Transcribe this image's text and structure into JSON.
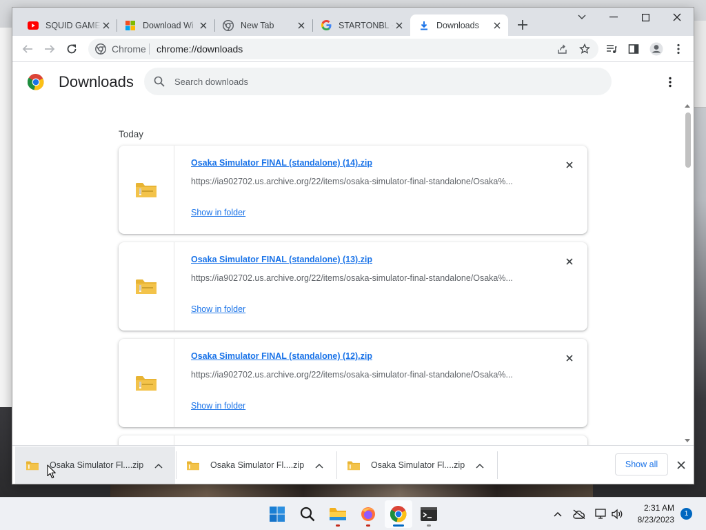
{
  "colors": {
    "link_blue": "#1a73e8",
    "tabstrip_bg": "#dee1e6",
    "youtube_red": "#ff0000",
    "folder_yellow": "#f3c34a",
    "taskbar_bg": "#eef0f4"
  },
  "tabs": [
    {
      "title": "SQUID GAME",
      "favicon": "youtube-icon",
      "active": false
    },
    {
      "title": "Download Wi",
      "favicon": "windows-logo-icon",
      "active": false
    },
    {
      "title": "New Tab",
      "favicon": "chrome-icon",
      "active": false
    },
    {
      "title": "STARTONBL -",
      "favicon": "google-icon",
      "active": false
    },
    {
      "title": "Downloads",
      "favicon": "download-icon",
      "active": true
    }
  ],
  "omnibox": {
    "chip_label": "Chrome",
    "url": "chrome://downloads"
  },
  "page": {
    "title": "Downloads",
    "search_placeholder": "Search downloads",
    "section_label": "Today"
  },
  "downloads": [
    {
      "file_name": "Osaka Simulator FINAL (standalone) (14).zip",
      "url": "https://ia902702.us.archive.org/22/items/osaka-simulator-final-standalone/Osaka%...",
      "action": "Show in folder"
    },
    {
      "file_name": "Osaka Simulator FINAL (standalone) (13).zip",
      "url": "https://ia902702.us.archive.org/22/items/osaka-simulator-final-standalone/Osaka%...",
      "action": "Show in folder"
    },
    {
      "file_name": "Osaka Simulator FINAL (standalone) (12).zip",
      "url": "https://ia902702.us.archive.org/22/items/osaka-simulator-final-standalone/Osaka%...",
      "action": "Show in folder"
    }
  ],
  "shelf": {
    "items": [
      {
        "name": "Osaka Simulator Fl....zip"
      },
      {
        "name": "Osaka Simulator Fl....zip"
      },
      {
        "name": "Osaka Simulator Fl....zip"
      }
    ],
    "show_all_label": "Show all"
  },
  "taskbar": {
    "apps": [
      "start-icon",
      "search-icon",
      "file-explorer-icon",
      "firefox-icon",
      "chrome-icon",
      "terminal-icon"
    ],
    "time": "2:31 AM",
    "date": "8/23/2023",
    "notification_count": "1"
  }
}
